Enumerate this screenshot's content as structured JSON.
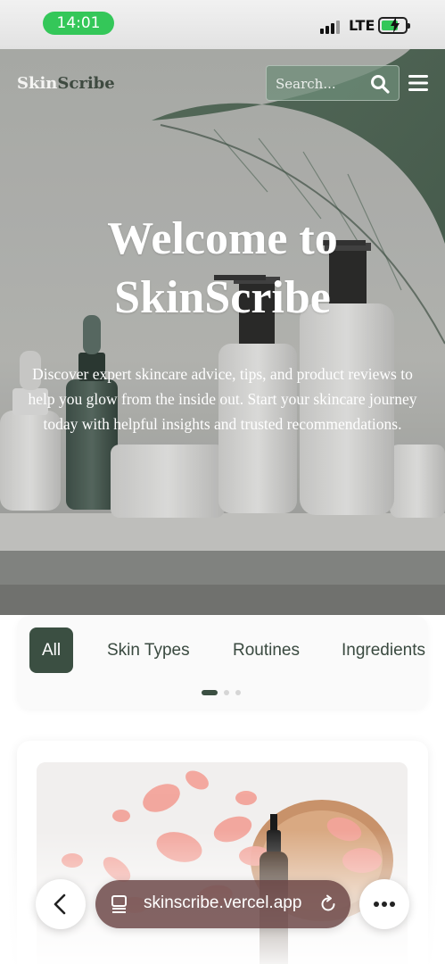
{
  "status_bar": {
    "time": "14:01",
    "network": "LTE"
  },
  "nav": {
    "logo_part1": "Skin",
    "logo_part2": "Scribe",
    "search_placeholder": "Search..."
  },
  "hero": {
    "title": "Welcome to SkinScribe",
    "description": "Discover expert skincare advice, tips, and product reviews to help you glow from the inside out. Start your skincare journey today with helpful insights and trusted recommendations."
  },
  "categories": {
    "tabs": [
      {
        "label": "All",
        "active": true
      },
      {
        "label": "Skin Types",
        "active": false
      },
      {
        "label": "Routines",
        "active": false
      },
      {
        "label": "Ingredients",
        "active": false
      }
    ],
    "page_dots": 3,
    "active_dot": 0
  },
  "browser": {
    "url": "skinscribe.vercel.app"
  },
  "colors": {
    "accent_green": "#3b4f42",
    "status_green": "#34c759",
    "url_bar": "#684242"
  },
  "icons": [
    "search-icon",
    "menu-icon",
    "chevron-left-icon",
    "tabs-icon",
    "reload-icon",
    "more-icon",
    "battery-icon",
    "signal-icon"
  ]
}
